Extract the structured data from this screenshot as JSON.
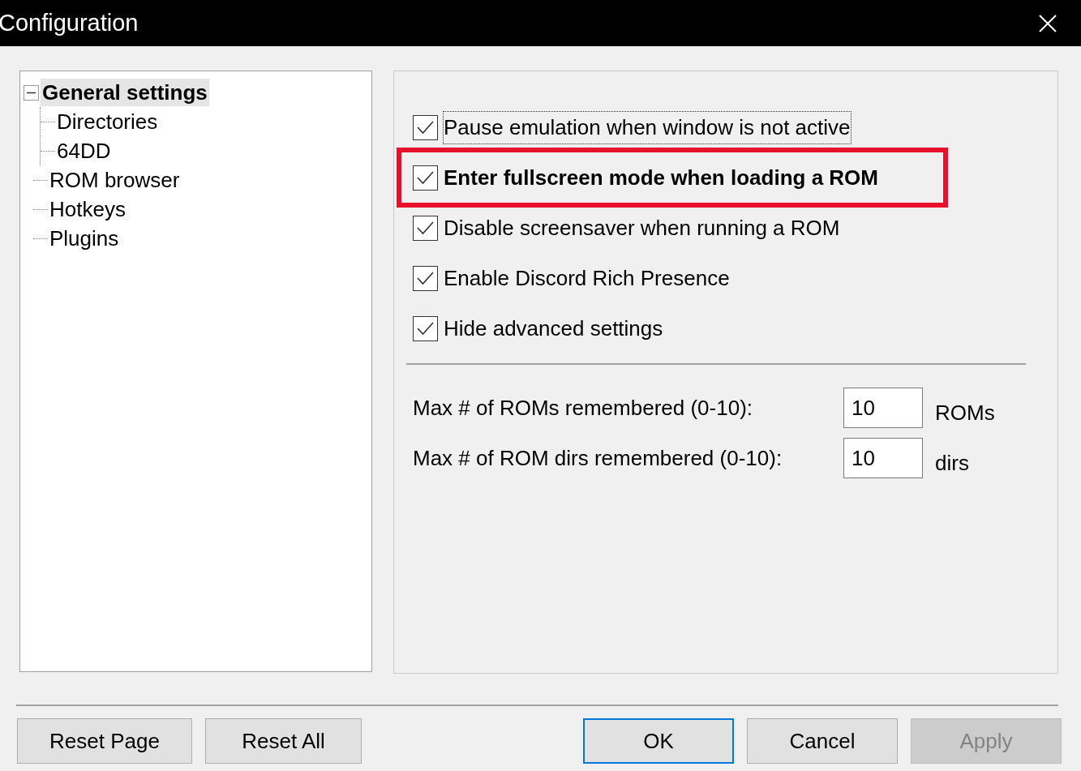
{
  "window": {
    "title": "Configuration"
  },
  "tree": [
    {
      "label": "General settings",
      "selected": true,
      "expanded": true,
      "children": [
        {
          "label": "Directories",
          "selected": false
        },
        {
          "label": "64DD",
          "selected": false
        }
      ]
    },
    {
      "label": "ROM browser",
      "selected": false
    },
    {
      "label": "Hotkeys",
      "selected": false
    },
    {
      "label": "Plugins",
      "selected": false
    }
  ],
  "options": [
    {
      "label": "Pause emulation when window is not active",
      "checked": true,
      "focused": true,
      "highlighted": false
    },
    {
      "label": "Enter fullscreen mode when loading a ROM",
      "checked": true,
      "focused": false,
      "highlighted": true
    },
    {
      "label": "Disable screensaver when running a ROM",
      "checked": true,
      "focused": false,
      "highlighted": false
    },
    {
      "label": "Enable Discord Rich Presence",
      "checked": true,
      "focused": false,
      "highlighted": false
    },
    {
      "label": "Hide advanced settings",
      "checked": true,
      "focused": false,
      "highlighted": false
    }
  ],
  "fields": [
    {
      "label": "Max # of ROMs remembered (0-10):",
      "value": "10",
      "unit": "ROMs"
    },
    {
      "label": "Max # of ROM dirs remembered (0-10):",
      "value": "10",
      "unit": "dirs"
    }
  ],
  "buttons_left": [
    {
      "label": "Reset Page",
      "default": false,
      "disabled": false
    },
    {
      "label": "Reset All",
      "default": false,
      "disabled": false
    }
  ],
  "buttons_right": [
    {
      "label": "OK",
      "default": true,
      "disabled": false
    },
    {
      "label": "Cancel",
      "default": false,
      "disabled": false
    },
    {
      "label": "Apply",
      "default": false,
      "disabled": true
    }
  ]
}
